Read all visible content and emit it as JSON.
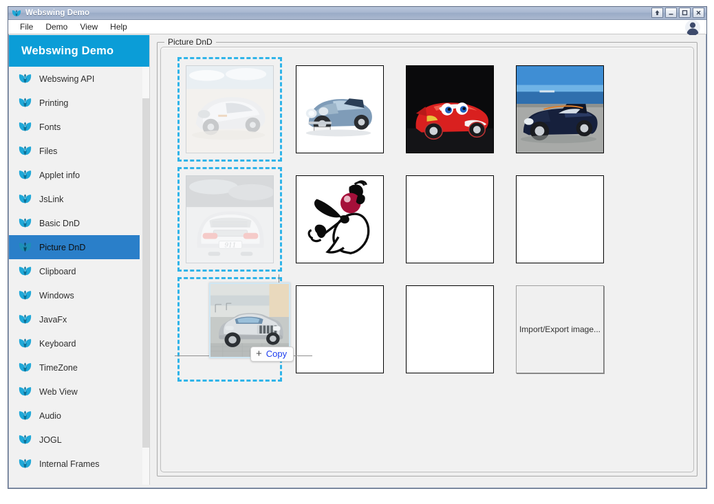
{
  "window": {
    "title": "Webswing Demo",
    "icon": "butterfly-icon",
    "controls": [
      {
        "name": "restore-up-button",
        "glyph": "↑"
      },
      {
        "name": "minimize-button",
        "glyph": "–"
      },
      {
        "name": "maximize-button",
        "glyph": "□"
      },
      {
        "name": "close-button",
        "glyph": "✕"
      }
    ]
  },
  "menubar": {
    "items": [
      {
        "label": "File",
        "name": "menu-file"
      },
      {
        "label": "Demo",
        "name": "menu-demo"
      },
      {
        "label": "View",
        "name": "menu-view"
      },
      {
        "label": "Help",
        "name": "menu-help"
      }
    ],
    "avatar_icon": "user-avatar-icon"
  },
  "sidebar": {
    "header": "Webswing Demo",
    "header_color": "#0b9dd7",
    "selected": "Picture DnD",
    "selected_color": "#2a7fc9",
    "items": [
      {
        "label": "Webswing API",
        "selected": false
      },
      {
        "label": "Printing",
        "selected": false
      },
      {
        "label": "Fonts",
        "selected": false
      },
      {
        "label": "Files",
        "selected": false
      },
      {
        "label": "Applet info",
        "selected": false
      },
      {
        "label": "JsLink",
        "selected": false
      },
      {
        "label": "Basic DnD",
        "selected": false
      },
      {
        "label": "Picture DnD",
        "selected": true
      },
      {
        "label": "Clipboard",
        "selected": false
      },
      {
        "label": "Windows",
        "selected": false
      },
      {
        "label": "JavaFx",
        "selected": false
      },
      {
        "label": "Keyboard",
        "selected": false
      },
      {
        "label": "TimeZone",
        "selected": false
      },
      {
        "label": "Web View",
        "selected": false
      },
      {
        "label": "Audio",
        "selected": false
      },
      {
        "label": "JOGL",
        "selected": false
      },
      {
        "label": "Internal Frames",
        "selected": false
      }
    ]
  },
  "panel": {
    "title": "Picture DnD"
  },
  "grid": {
    "drop_border_color": "#2fb4e9",
    "cells": [
      {
        "row": 0,
        "col": 0,
        "kind": "image",
        "art": "silver-bugatti",
        "dropzone": true,
        "faded": true,
        "alt": "Silver sports car"
      },
      {
        "row": 0,
        "col": 1,
        "kind": "image",
        "art": "blue-healey",
        "dropzone": false,
        "faded": false,
        "alt": "Blue classic convertible"
      },
      {
        "row": 0,
        "col": 2,
        "kind": "image",
        "art": "red-mcqueen",
        "dropzone": false,
        "faded": false,
        "alt": "Red cartoon race car"
      },
      {
        "row": 0,
        "col": 3,
        "kind": "image",
        "art": "blue-morgan",
        "dropzone": false,
        "faded": false,
        "alt": "Dark blue roadster by the sea"
      },
      {
        "row": 1,
        "col": 0,
        "kind": "image",
        "art": "porsche-911-rear",
        "dropzone": true,
        "faded": true,
        "alt": "Porsche 911 rear view"
      },
      {
        "row": 1,
        "col": 1,
        "kind": "image",
        "art": "duke-mascot",
        "dropzone": false,
        "faded": false,
        "alt": "Black and white mascot drawing"
      },
      {
        "row": 1,
        "col": 2,
        "kind": "empty",
        "dropzone": false,
        "faded": false,
        "alt": ""
      },
      {
        "row": 1,
        "col": 3,
        "kind": "empty",
        "dropzone": false,
        "faded": false,
        "alt": ""
      },
      {
        "row": 2,
        "col": 0,
        "kind": "drag",
        "art": "silver-jeep",
        "dropzone": true,
        "faded": false,
        "alt": "Silver SUV being dragged"
      },
      {
        "row": 2,
        "col": 1,
        "kind": "empty",
        "dropzone": false,
        "faded": false,
        "alt": ""
      },
      {
        "row": 2,
        "col": 2,
        "kind": "empty",
        "dropzone": false,
        "faded": false,
        "alt": ""
      },
      {
        "row": 2,
        "col": 3,
        "kind": "button",
        "label": "Import/Export image...",
        "dropzone": false,
        "faded": false,
        "alt": ""
      }
    ]
  },
  "drag": {
    "badge_plus": "+",
    "badge_label": "Copy",
    "badge_text_color": "#1d3ef0"
  }
}
